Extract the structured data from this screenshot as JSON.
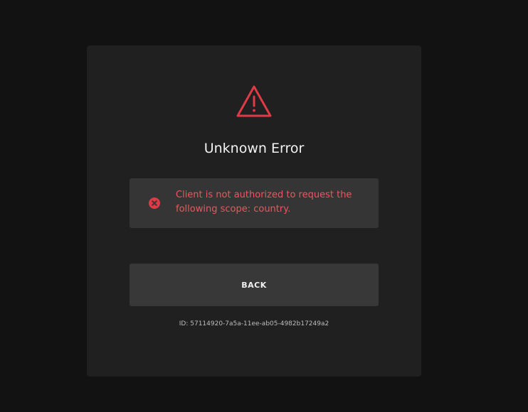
{
  "error": {
    "title": "Unknown Error",
    "message": "Client is not authorized to request the following scope: country.",
    "back_label": "BACK",
    "request_id": "ID: 57114920-7a5a-11ee-ab05-4982b17249a2"
  },
  "icons": {
    "header": "warning-triangle-icon",
    "alert": "error-circle-icon"
  },
  "colors": {
    "background": "#121212",
    "card": "#202020",
    "accent_red": "#e03a47",
    "alert_text": "#ef5560",
    "alert_bg": "#353535",
    "button_bg": "#383838"
  }
}
